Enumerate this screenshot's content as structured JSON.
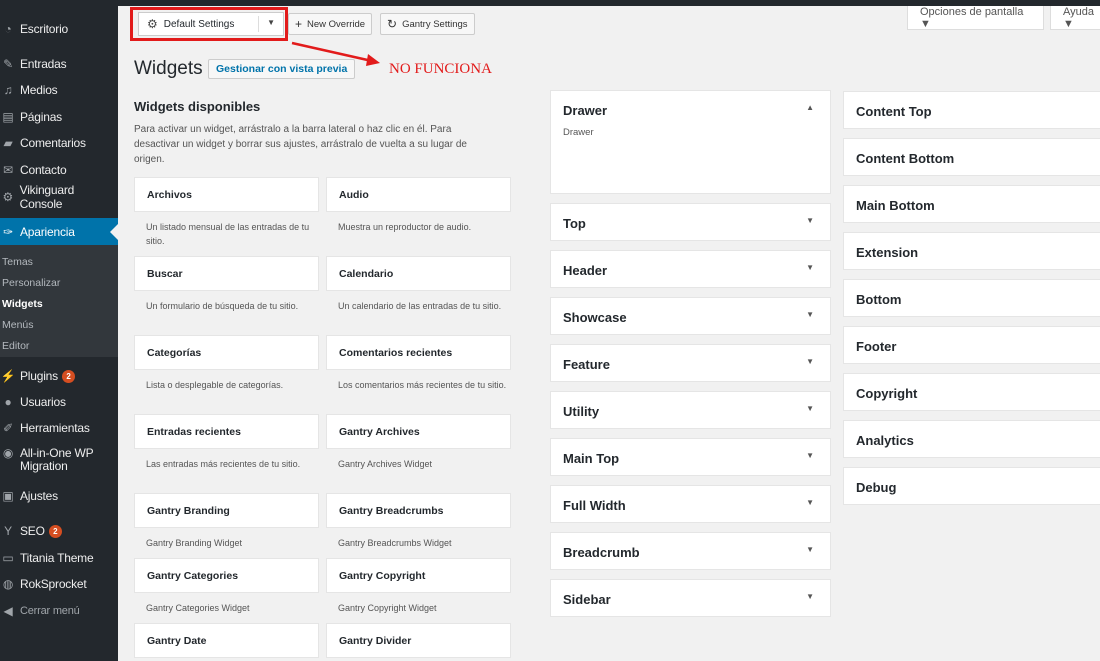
{
  "toolbar": {
    "config_select": "Default Settings",
    "new_override": "New Override",
    "gantry_settings": "Gantry Settings",
    "screen_options": "Opciones de pantalla ▼",
    "help": "Ayuda ▼"
  },
  "annotation": {
    "note": "NO FUNCIONA",
    "color": "#e21b1b"
  },
  "sidebar": {
    "items": [
      {
        "label": "Escritorio",
        "icon": "gauge-icon"
      },
      {
        "label": "Entradas",
        "icon": "pin-icon"
      },
      {
        "label": "Medios",
        "icon": "media-icon"
      },
      {
        "label": "Páginas",
        "icon": "page-icon"
      },
      {
        "label": "Comentarios",
        "icon": "comment-icon"
      },
      {
        "label": "Contacto",
        "icon": "mail-icon"
      },
      {
        "label": "Vikinguard Console",
        "icon": "gear-icon"
      },
      {
        "label": "Apariencia",
        "icon": "brush-icon"
      },
      {
        "label": "Plugins",
        "icon": "plug-icon",
        "badge": "2"
      },
      {
        "label": "Usuarios",
        "icon": "users-icon"
      },
      {
        "label": "Herramientas",
        "icon": "wrench-icon"
      },
      {
        "label": "All-in-One WP Migration",
        "icon": "migration-icon"
      },
      {
        "label": "Ajustes",
        "icon": "settings-icon"
      },
      {
        "label": "SEO",
        "icon": "seo-icon",
        "badge": "2"
      },
      {
        "label": "Titania Theme",
        "icon": "theme-icon"
      },
      {
        "label": "RokSprocket",
        "icon": "rocket-icon"
      },
      {
        "label": "Cerrar menú",
        "icon": "collapse-icon"
      }
    ],
    "submenu": [
      "Temas",
      "Personalizar",
      "Widgets",
      "Menús",
      "Editor"
    ]
  },
  "page": {
    "title": "Widgets",
    "preview_button": "Gestionar con vista previa",
    "available_title": "Widgets disponibles",
    "available_desc": "Para activar un widget, arrástralo a la barra lateral o haz clic en él. Para desactivar un widget y borrar sus ajustes, arrástralo de vuelta a su lugar de origen."
  },
  "widgets": [
    {
      "name": "Archivos",
      "desc": "Un listado mensual de las entradas de tu sitio."
    },
    {
      "name": "Audio",
      "desc": "Muestra un reproductor de audio."
    },
    {
      "name": "Buscar",
      "desc": "Un formulario de búsqueda de tu sitio."
    },
    {
      "name": "Calendario",
      "desc": "Un calendario de las entradas de tu sitio."
    },
    {
      "name": "Categorías",
      "desc": "Lista o desplegable de categorías."
    },
    {
      "name": "Comentarios recientes",
      "desc": "Los comentarios más recientes de tu sitio."
    },
    {
      "name": "Entradas recientes",
      "desc": "Las entradas más recientes de tu sitio."
    },
    {
      "name": "Gantry Archives",
      "desc": "Gantry Archives Widget"
    },
    {
      "name": "Gantry Branding",
      "desc": "Gantry Branding Widget"
    },
    {
      "name": "Gantry Breadcrumbs",
      "desc": "Gantry Breadcrumbs Widget"
    },
    {
      "name": "Gantry Categories",
      "desc": "Gantry Categories Widget"
    },
    {
      "name": "Gantry Copyright",
      "desc": "Gantry Copyright Widget"
    },
    {
      "name": "Gantry Date",
      "desc": ""
    },
    {
      "name": "Gantry Divider",
      "desc": ""
    }
  ],
  "areas_left": [
    {
      "name": "Drawer",
      "sub": "Drawer",
      "open": true
    },
    {
      "name": "Top"
    },
    {
      "name": "Header"
    },
    {
      "name": "Showcase"
    },
    {
      "name": "Feature"
    },
    {
      "name": "Utility"
    },
    {
      "name": "Main Top"
    },
    {
      "name": "Full Width"
    },
    {
      "name": "Breadcrumb"
    },
    {
      "name": "Sidebar"
    }
  ],
  "areas_right": [
    {
      "name": "Content Top"
    },
    {
      "name": "Content Bottom"
    },
    {
      "name": "Main Bottom"
    },
    {
      "name": "Extension"
    },
    {
      "name": "Bottom"
    },
    {
      "name": "Footer"
    },
    {
      "name": "Copyright"
    },
    {
      "name": "Analytics"
    },
    {
      "name": "Debug"
    }
  ],
  "colors": {
    "sidebar_bg": "#23282d",
    "active": "#0073aa",
    "badge": "#d54e21"
  }
}
